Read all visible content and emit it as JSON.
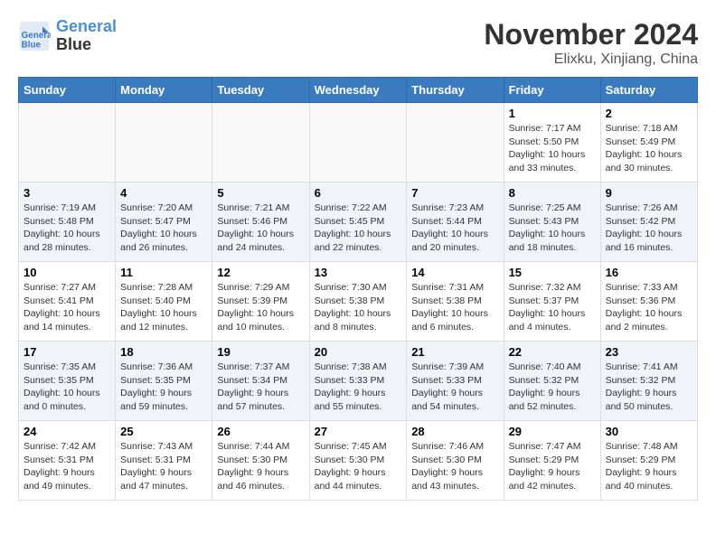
{
  "header": {
    "logo_line1": "General",
    "logo_line2": "Blue",
    "month_title": "November 2024",
    "location": "Elixku, Xinjiang, China"
  },
  "weekdays": [
    "Sunday",
    "Monday",
    "Tuesday",
    "Wednesday",
    "Thursday",
    "Friday",
    "Saturday"
  ],
  "weeks": [
    [
      {
        "day": "",
        "info": ""
      },
      {
        "day": "",
        "info": ""
      },
      {
        "day": "",
        "info": ""
      },
      {
        "day": "",
        "info": ""
      },
      {
        "day": "",
        "info": ""
      },
      {
        "day": "1",
        "info": "Sunrise: 7:17 AM\nSunset: 5:50 PM\nDaylight: 10 hours and 33 minutes."
      },
      {
        "day": "2",
        "info": "Sunrise: 7:18 AM\nSunset: 5:49 PM\nDaylight: 10 hours and 30 minutes."
      }
    ],
    [
      {
        "day": "3",
        "info": "Sunrise: 7:19 AM\nSunset: 5:48 PM\nDaylight: 10 hours and 28 minutes."
      },
      {
        "day": "4",
        "info": "Sunrise: 7:20 AM\nSunset: 5:47 PM\nDaylight: 10 hours and 26 minutes."
      },
      {
        "day": "5",
        "info": "Sunrise: 7:21 AM\nSunset: 5:46 PM\nDaylight: 10 hours and 24 minutes."
      },
      {
        "day": "6",
        "info": "Sunrise: 7:22 AM\nSunset: 5:45 PM\nDaylight: 10 hours and 22 minutes."
      },
      {
        "day": "7",
        "info": "Sunrise: 7:23 AM\nSunset: 5:44 PM\nDaylight: 10 hours and 20 minutes."
      },
      {
        "day": "8",
        "info": "Sunrise: 7:25 AM\nSunset: 5:43 PM\nDaylight: 10 hours and 18 minutes."
      },
      {
        "day": "9",
        "info": "Sunrise: 7:26 AM\nSunset: 5:42 PM\nDaylight: 10 hours and 16 minutes."
      }
    ],
    [
      {
        "day": "10",
        "info": "Sunrise: 7:27 AM\nSunset: 5:41 PM\nDaylight: 10 hours and 14 minutes."
      },
      {
        "day": "11",
        "info": "Sunrise: 7:28 AM\nSunset: 5:40 PM\nDaylight: 10 hours and 12 minutes."
      },
      {
        "day": "12",
        "info": "Sunrise: 7:29 AM\nSunset: 5:39 PM\nDaylight: 10 hours and 10 minutes."
      },
      {
        "day": "13",
        "info": "Sunrise: 7:30 AM\nSunset: 5:38 PM\nDaylight: 10 hours and 8 minutes."
      },
      {
        "day": "14",
        "info": "Sunrise: 7:31 AM\nSunset: 5:38 PM\nDaylight: 10 hours and 6 minutes."
      },
      {
        "day": "15",
        "info": "Sunrise: 7:32 AM\nSunset: 5:37 PM\nDaylight: 10 hours and 4 minutes."
      },
      {
        "day": "16",
        "info": "Sunrise: 7:33 AM\nSunset: 5:36 PM\nDaylight: 10 hours and 2 minutes."
      }
    ],
    [
      {
        "day": "17",
        "info": "Sunrise: 7:35 AM\nSunset: 5:35 PM\nDaylight: 10 hours and 0 minutes."
      },
      {
        "day": "18",
        "info": "Sunrise: 7:36 AM\nSunset: 5:35 PM\nDaylight: 9 hours and 59 minutes."
      },
      {
        "day": "19",
        "info": "Sunrise: 7:37 AM\nSunset: 5:34 PM\nDaylight: 9 hours and 57 minutes."
      },
      {
        "day": "20",
        "info": "Sunrise: 7:38 AM\nSunset: 5:33 PM\nDaylight: 9 hours and 55 minutes."
      },
      {
        "day": "21",
        "info": "Sunrise: 7:39 AM\nSunset: 5:33 PM\nDaylight: 9 hours and 54 minutes."
      },
      {
        "day": "22",
        "info": "Sunrise: 7:40 AM\nSunset: 5:32 PM\nDaylight: 9 hours and 52 minutes."
      },
      {
        "day": "23",
        "info": "Sunrise: 7:41 AM\nSunset: 5:32 PM\nDaylight: 9 hours and 50 minutes."
      }
    ],
    [
      {
        "day": "24",
        "info": "Sunrise: 7:42 AM\nSunset: 5:31 PM\nDaylight: 9 hours and 49 minutes."
      },
      {
        "day": "25",
        "info": "Sunrise: 7:43 AM\nSunset: 5:31 PM\nDaylight: 9 hours and 47 minutes."
      },
      {
        "day": "26",
        "info": "Sunrise: 7:44 AM\nSunset: 5:30 PM\nDaylight: 9 hours and 46 minutes."
      },
      {
        "day": "27",
        "info": "Sunrise: 7:45 AM\nSunset: 5:30 PM\nDaylight: 9 hours and 44 minutes."
      },
      {
        "day": "28",
        "info": "Sunrise: 7:46 AM\nSunset: 5:30 PM\nDaylight: 9 hours and 43 minutes."
      },
      {
        "day": "29",
        "info": "Sunrise: 7:47 AM\nSunset: 5:29 PM\nDaylight: 9 hours and 42 minutes."
      },
      {
        "day": "30",
        "info": "Sunrise: 7:48 AM\nSunset: 5:29 PM\nDaylight: 9 hours and 40 minutes."
      }
    ]
  ]
}
